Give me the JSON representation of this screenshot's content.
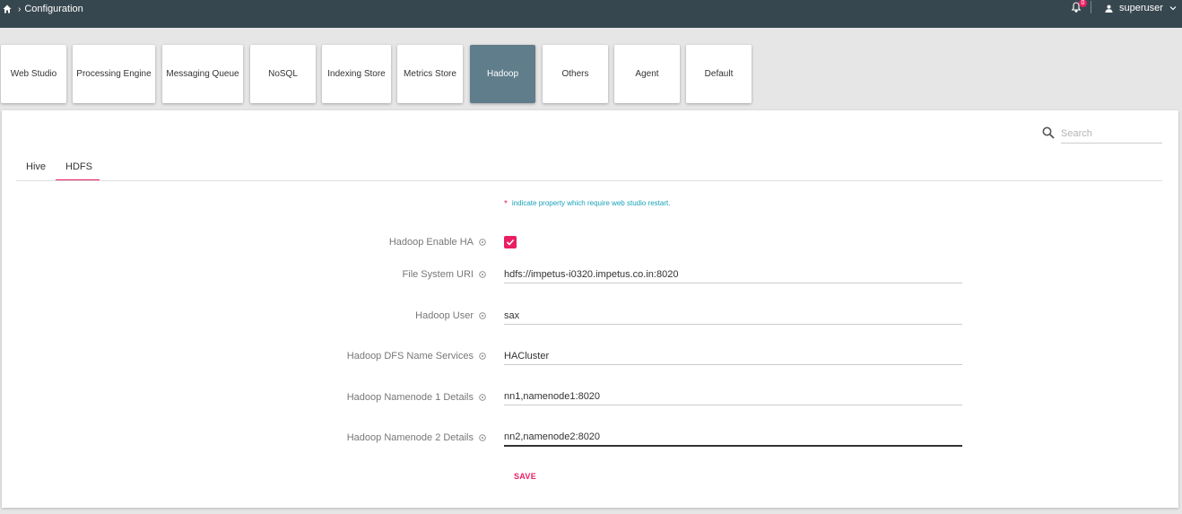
{
  "header": {
    "breadcrumb": "Configuration",
    "notification_count": "0",
    "username": "superuser"
  },
  "categories": [
    "Web Studio",
    "Processing Engine",
    "Messaging Queue",
    "NoSQL",
    "Indexing Store",
    "Metrics Store",
    "Hadoop",
    "Others",
    "Agent",
    "Default"
  ],
  "active_category": "Hadoop",
  "search": {
    "placeholder": "Search"
  },
  "subtabs": [
    "Hive",
    "HDFS"
  ],
  "active_subtab": "HDFS",
  "note": {
    "star": "*",
    "text": "indicate property which require web studio restart."
  },
  "form": {
    "enable_ha": {
      "label": "Hadoop Enable HA",
      "checked": true
    },
    "file_system_uri": {
      "label": "File System URI",
      "value": "hdfs://impetus-i0320.impetus.co.in:8020"
    },
    "hadoop_user": {
      "label": "Hadoop User",
      "value": "sax"
    },
    "dfs_name_services": {
      "label": "Hadoop DFS Name Services",
      "value": "HACluster"
    },
    "namenode1": {
      "label": "Hadoop Namenode 1 Details",
      "value": "nn1,namenode1:8020"
    },
    "namenode2": {
      "label": "Hadoop Namenode 2 Details",
      "value": "nn2,namenode2:8020"
    },
    "save_label": "SAVE"
  },
  "colors": {
    "topbar": "#37474f",
    "active_tab": "#607d8b",
    "accent": "#e91e63",
    "note": "#17a2b8"
  }
}
